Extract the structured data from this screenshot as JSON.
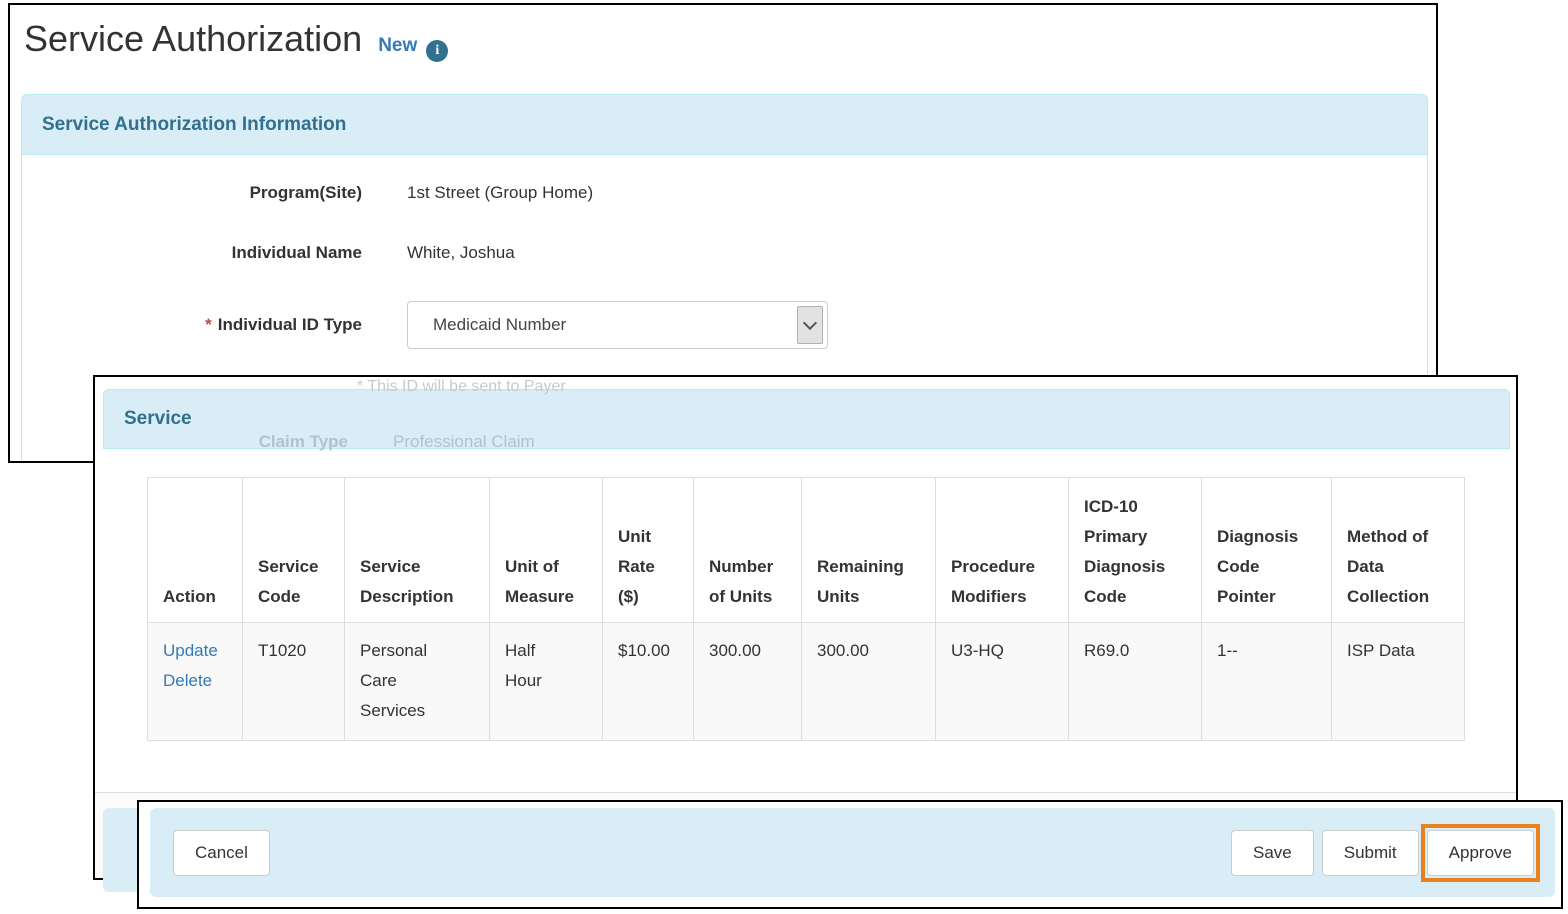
{
  "colors": {
    "section_header_bg": "#d9edf7",
    "section_header_text": "#31708f",
    "link_blue": "#337ab7",
    "highlight_orange": "#e8821e",
    "required_red": "#b94a48",
    "annotation_border": "#000000"
  },
  "page": {
    "title": "Service Authorization",
    "status_badge": "New",
    "info_icon_glyph": "i"
  },
  "auth_info": {
    "heading": "Service Authorization Information",
    "required_marker": "*",
    "fields": [
      {
        "label": "Program(Site)",
        "value": "1st Street (Group Home)"
      },
      {
        "label": "Individual Name",
        "value": "White, Joshua"
      },
      {
        "label": "Individual ID Type",
        "value": "Medicaid Number"
      }
    ],
    "ghost_note": "* This ID will be sent to Payer",
    "ghost_field": {
      "label": "Claim Type",
      "value": "Professional Claim"
    }
  },
  "service": {
    "heading": "Service",
    "table": {
      "columns": [
        "Action",
        "Service Code",
        "Service Description",
        "Unit of Measure",
        "Unit Rate ($)",
        "Number of Units",
        "Remaining Units",
        "Procedure Modifiers",
        "ICD-10 Primary Diagnosis Code",
        "Diagnosis Code Pointer",
        "Method of Data Collection"
      ],
      "rows": [
        {
          "actions": [
            "Update",
            "Delete"
          ],
          "service_code": "T1020",
          "service_description": "Personal Care Services",
          "unit_of_measure": "Half Hour",
          "unit_rate": "$10.00",
          "number_of_units": "300.00",
          "remaining_units": "300.00",
          "procedure_modifiers": "U3-HQ",
          "icd10_primary_diagnosis_code": "R69.0",
          "diagnosis_code_pointer": "1--",
          "method_of_data_collection": "ISP Data"
        }
      ]
    }
  },
  "footer": {
    "cancel_label": "Cancel",
    "save_label": "Save",
    "submit_label": "Submit",
    "approve_label": "Approve"
  }
}
